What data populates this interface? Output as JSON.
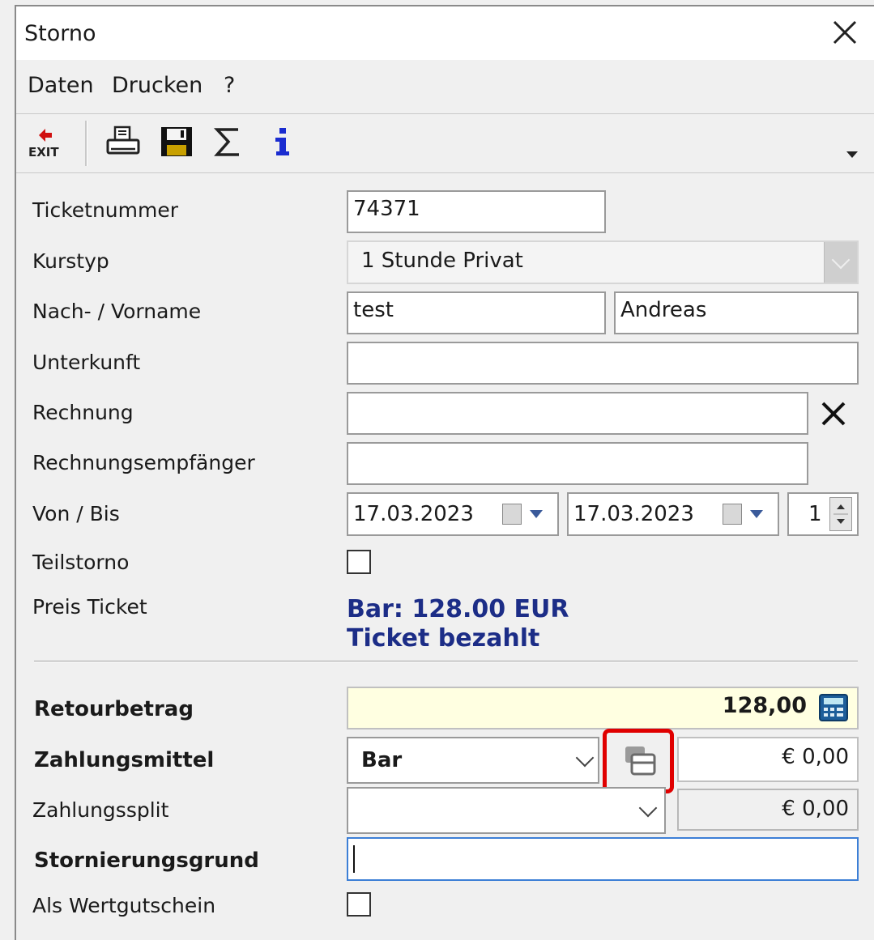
{
  "window": {
    "title": "Storno"
  },
  "menu": {
    "items": [
      "Daten",
      "Drucken",
      "?"
    ]
  },
  "toolbar": {
    "exit_label": "EXIT",
    "icons": [
      "exit-icon",
      "print-icon",
      "save-icon",
      "sum-icon",
      "info-icon"
    ]
  },
  "form": {
    "ticketnummer": {
      "label": "Ticketnummer",
      "value": "74371"
    },
    "kurstyp": {
      "label": "Kurstyp",
      "value": "1 Stunde Privat"
    },
    "name": {
      "label": "Nach- / Vorname",
      "last": "test",
      "first": "Andreas"
    },
    "unterkunft": {
      "label": "Unterkunft",
      "value": ""
    },
    "rechnung": {
      "label": "Rechnung",
      "value": ""
    },
    "rechnungsempfaenger": {
      "label": "Rechnungsempfänger",
      "value": ""
    },
    "von_bis": {
      "label": "Von / Bis",
      "from": "17.03.2023",
      "to": "17.03.2023",
      "count": "1"
    },
    "teilstorno": {
      "label": "Teilstorno",
      "checked": false
    },
    "preis_ticket": {
      "label": "Preis Ticket",
      "line1": "Bar: 128.00 EUR",
      "line2": "Ticket bezahlt"
    },
    "retourbetrag": {
      "label": "Retourbetrag",
      "value": "128,00"
    },
    "zahlungsmittel": {
      "label": "Zahlungsmittel",
      "value": "Bar",
      "amount": "€ 0,00"
    },
    "zahlungssplit": {
      "label": "Zahlungssplit",
      "value": "",
      "amount": "€ 0,00"
    },
    "stornierungsgrund": {
      "label": "Stornierungsgrund",
      "value": ""
    },
    "wertgutschein": {
      "label": "Als Wertgutschein",
      "checked": false
    }
  },
  "colors": {
    "info_text": "#1c2d87",
    "retour_bg": "#ffffe1",
    "highlight": "#e00000",
    "focus_border": "#3c7fd6"
  }
}
